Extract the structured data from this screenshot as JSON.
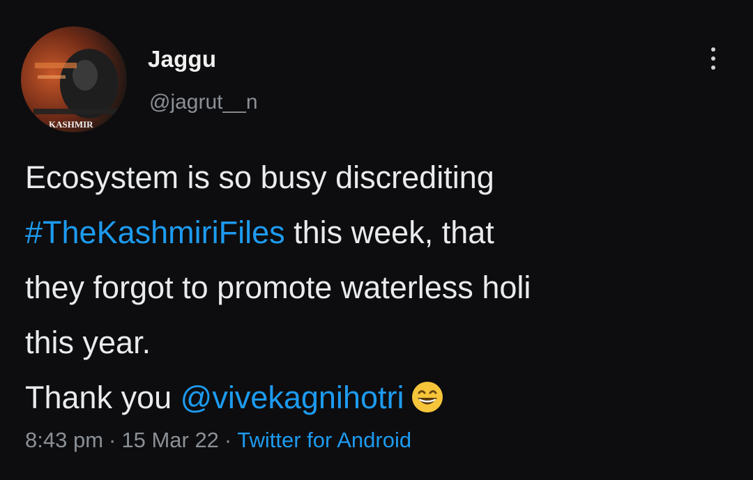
{
  "tweet": {
    "author": {
      "display_name": "Jaggu",
      "handle": "@jagrut__n",
      "avatar_icon": "avatar-image",
      "avatar_text": "KASHMIR"
    },
    "menu_icon": "more-vertical-icon",
    "text": {
      "line1": "Ecosystem is so busy discrediting",
      "hashtag": "#TheKashmiriFiles",
      "line2_rest": " this week, that",
      "line3": "they forgot to promote waterless holi",
      "line4": "this year.",
      "line5_prefix": "Thank you ",
      "mention": "@vivekagnihotri",
      "emoji": "grinning-squinting-face-emoji"
    },
    "meta": {
      "time": "8:43 pm",
      "separator": "·",
      "date": "15 Mar 22",
      "source": "Twitter for Android"
    },
    "colors": {
      "background": "#0d0d0f",
      "text": "#e9ebec",
      "secondary": "#8b9096",
      "link": "#1d9bf0"
    }
  }
}
